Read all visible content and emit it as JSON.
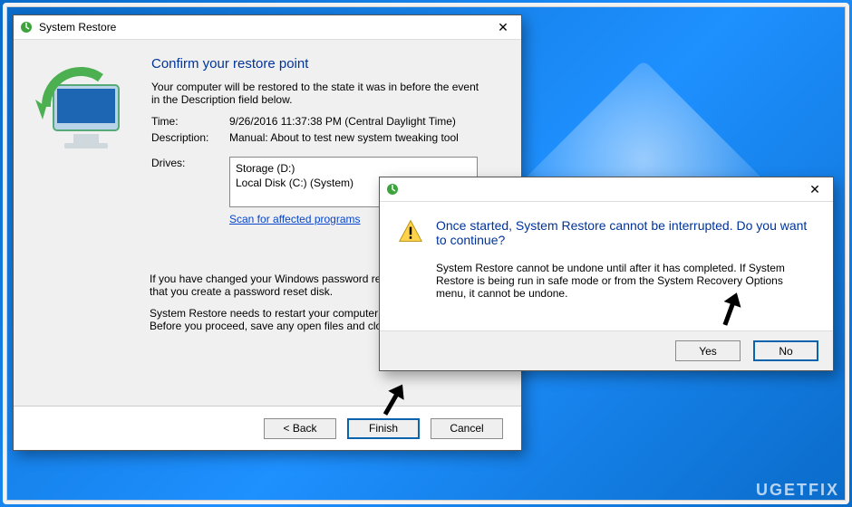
{
  "mainWindow": {
    "title": "System Restore",
    "heading": "Confirm your restore point",
    "intro": "Your computer will be restored to the state it was in before the event in the Description field below.",
    "labels": {
      "time": "Time:",
      "description": "Description:",
      "drives": "Drives:"
    },
    "time": "9/26/2016 11:37:38 PM (Central Daylight Time)",
    "description": "Manual: About to test new system tweaking tool",
    "drives": [
      "Storage (D:)",
      "Local Disk (C:) (System)"
    ],
    "scanLink": "Scan for affected programs",
    "pwNote": "If you have changed your Windows password recently, we recommend that you create a password reset disk.",
    "restartNote": "System Restore needs to restart your computer to apply these changes. Before you proceed, save any open files and close all programs.",
    "buttons": {
      "back": "< Back",
      "finish": "Finish",
      "cancel": "Cancel"
    }
  },
  "dialog": {
    "headline": "Once started, System Restore cannot be interrupted. Do you want to continue?",
    "body": "System Restore cannot be undone until after it has completed. If System Restore is being run in safe mode or from the System Recovery Options menu, it cannot be undone.",
    "yes": "Yes",
    "no": "No"
  },
  "watermark": "UGETFIX"
}
